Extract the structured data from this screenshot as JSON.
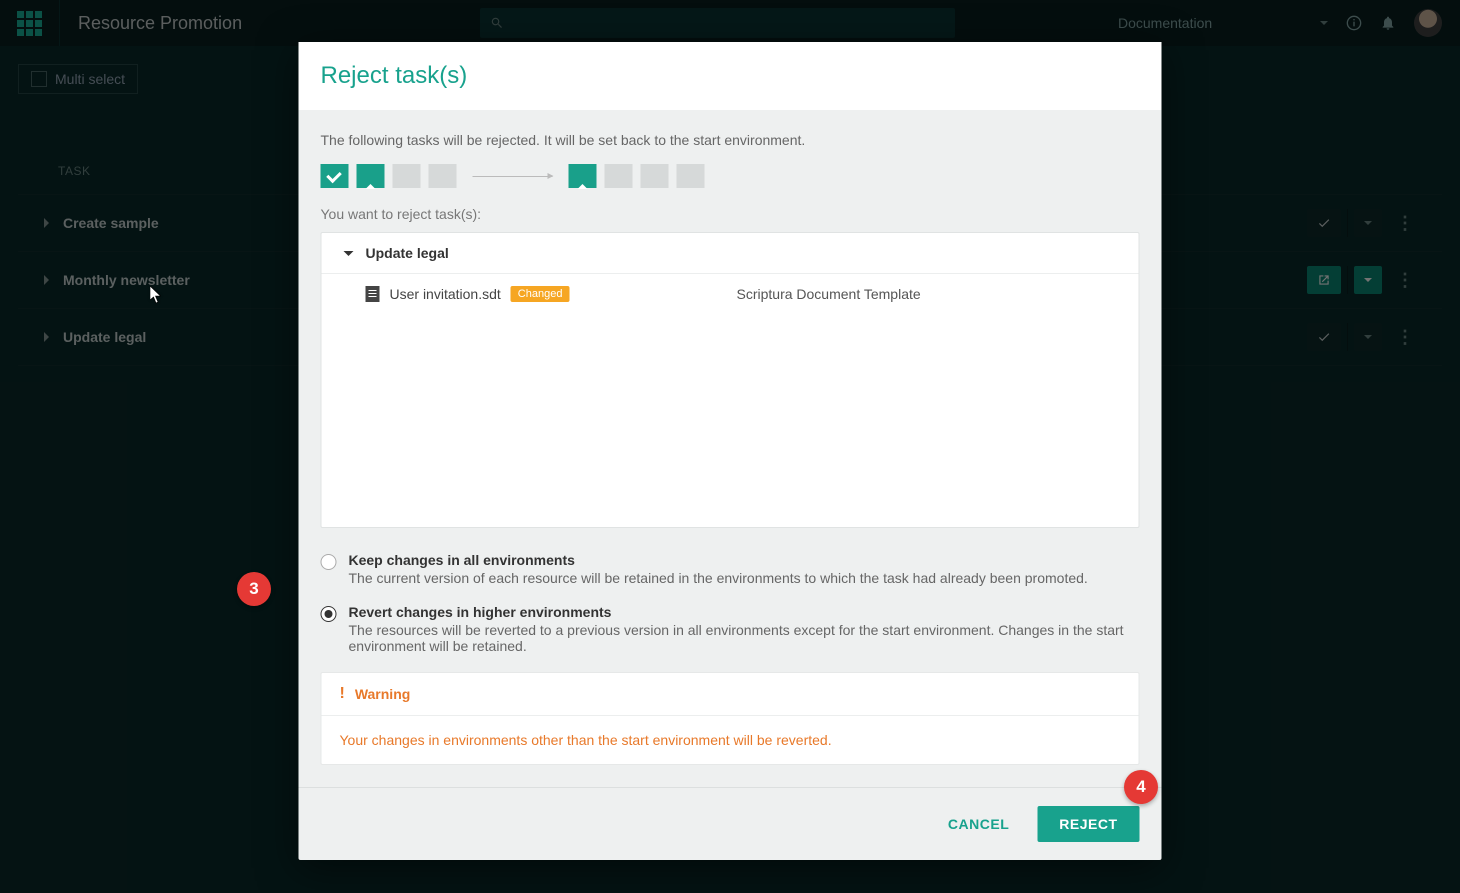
{
  "topbar": {
    "app_title": "Resource Promotion",
    "doc_label": "Documentation"
  },
  "page": {
    "multiselect_label": "Multi select",
    "task_header": "TASK",
    "tasks": [
      {
        "name": "Create sample"
      },
      {
        "name": "Monthly newsletter"
      },
      {
        "name": "Update legal"
      }
    ]
  },
  "modal": {
    "title": "Reject task(s)",
    "description": "The following tasks will be rejected. It will be set back to the start environment.",
    "subdescription": "You want to reject task(s):",
    "task_group": "Update legal",
    "file_name": "User invitation.sdt",
    "file_badge": "Changed",
    "file_type": "Scriptura Document Template",
    "option1_label": "Keep changes in all environments",
    "option1_text": "The current version of each resource will be retained in the environments to which the task had already been promoted.",
    "option2_label": "Revert changes in higher environments",
    "option2_text": "The resources will be reverted to a previous version in all environments except for the start environment. Changes in the start environment will be retained.",
    "warning_title": "Warning",
    "warning_body": "Your changes in environments other than the start environment will be reverted.",
    "cancel": "CANCEL",
    "reject": "REJECT"
  },
  "callouts": {
    "c3": "3",
    "c4": "4"
  }
}
